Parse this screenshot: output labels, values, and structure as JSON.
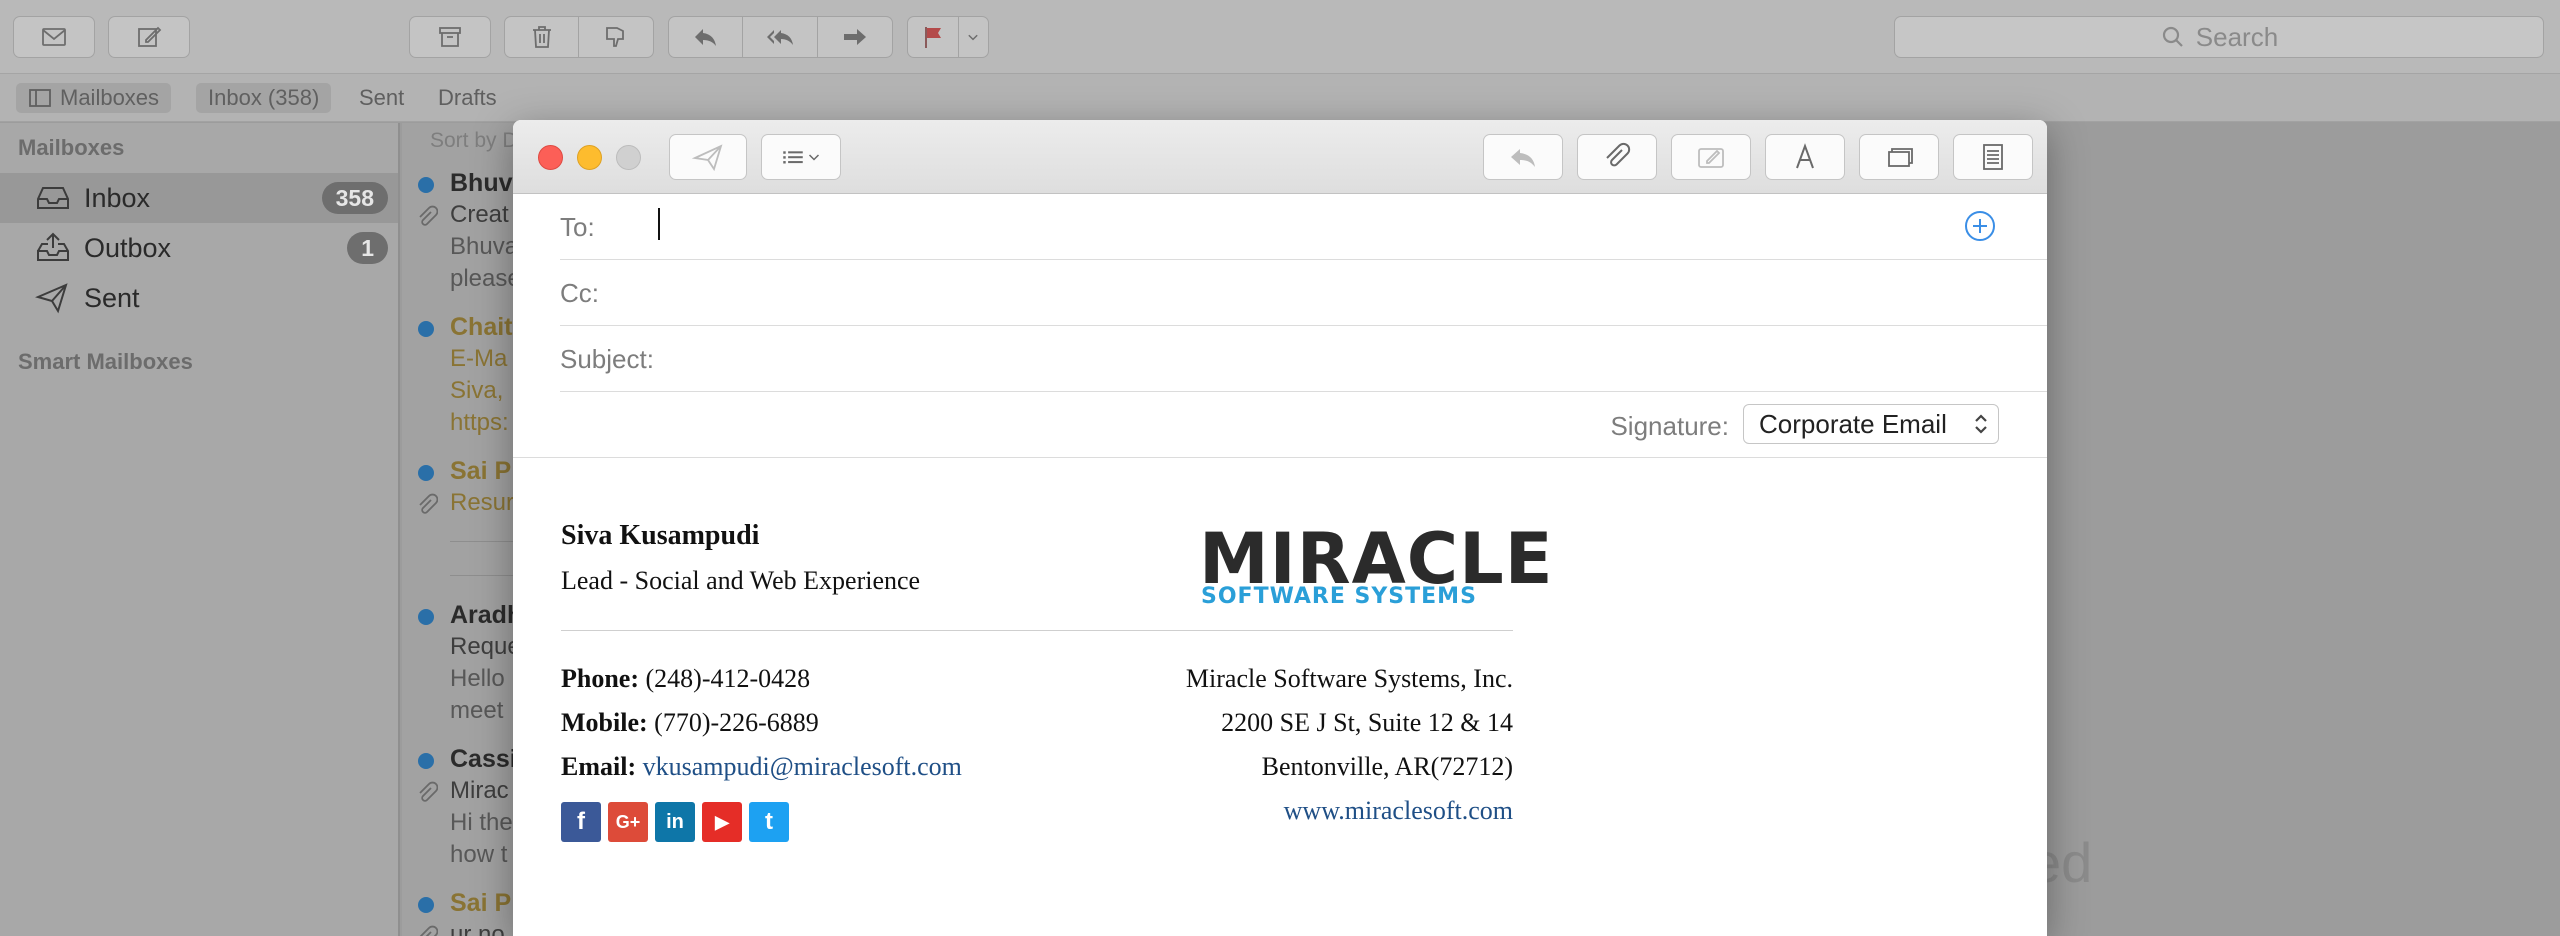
{
  "toolbar": {
    "search_placeholder": "Search"
  },
  "favorites": [
    {
      "label": "Mailboxes"
    },
    {
      "label": "Inbox (358)"
    },
    {
      "label": "Sent"
    },
    {
      "label": "Drafts"
    }
  ],
  "sidebar": {
    "header": "Mailboxes",
    "items": [
      {
        "label": "Inbox",
        "count": "358"
      },
      {
        "label": "Outbox",
        "count": "1"
      },
      {
        "label": "Sent",
        "count": ""
      }
    ],
    "smart_header": "Smart Mailboxes"
  },
  "message_list": {
    "sort_label": "Sort by D",
    "messages": [
      {
        "from": "Bhuv",
        "subject": "Creat",
        "preview1": "Bhuva",
        "preview2": "please"
      },
      {
        "from": "Chait",
        "subject": "E-Ma",
        "preview1": "Siva,",
        "preview2": "https:"
      },
      {
        "from": "Sai P",
        "subject": "Resur",
        "preview1": "",
        "preview2": ""
      },
      {
        "from": "Aradh",
        "subject": "Reque",
        "preview1": "Hello",
        "preview2": "meet"
      },
      {
        "from": "Cassi",
        "subject": "Mirac",
        "preview1": "Hi the",
        "preview2": "how t"
      },
      {
        "from": "Sai P",
        "subject": "ur no",
        "preview1": "",
        "preview2": ""
      }
    ],
    "ghost_text": "ed"
  },
  "compose": {
    "to_label": "To:",
    "cc_label": "Cc:",
    "subject_label": "Subject:",
    "signature_label": "Signature:",
    "signature_value": "Corporate Email"
  },
  "signature": {
    "name": "Siva Kusampudi",
    "role": "Lead - Social and Web Experience",
    "logo_word": "MIRACLE",
    "logo_tag": "SOFTWARE SYSTEMS",
    "phone_label": "Phone:",
    "phone": "(248)-412-0428",
    "mobile_label": "Mobile:",
    "mobile": "(770)-226-6889",
    "email_label": "Email:",
    "email": "vkusampudi@miraclesoft.com",
    "company": "Miracle Software Systems, Inc.",
    "address1": "2200 SE J St, Suite 12 & 14",
    "address2": "Bentonville, AR(72712)",
    "website": "www.miraclesoft.com",
    "social": [
      {
        "name": "facebook",
        "glyph": "f",
        "color": "#3b5998"
      },
      {
        "name": "google-plus",
        "glyph": "G+",
        "color": "#dd4b39"
      },
      {
        "name": "linkedin",
        "glyph": "in",
        "color": "#0e76a8"
      },
      {
        "name": "youtube",
        "glyph": "▶",
        "color": "#e52d27"
      },
      {
        "name": "twitter",
        "glyph": "t",
        "color": "#1da1f2"
      }
    ]
  }
}
